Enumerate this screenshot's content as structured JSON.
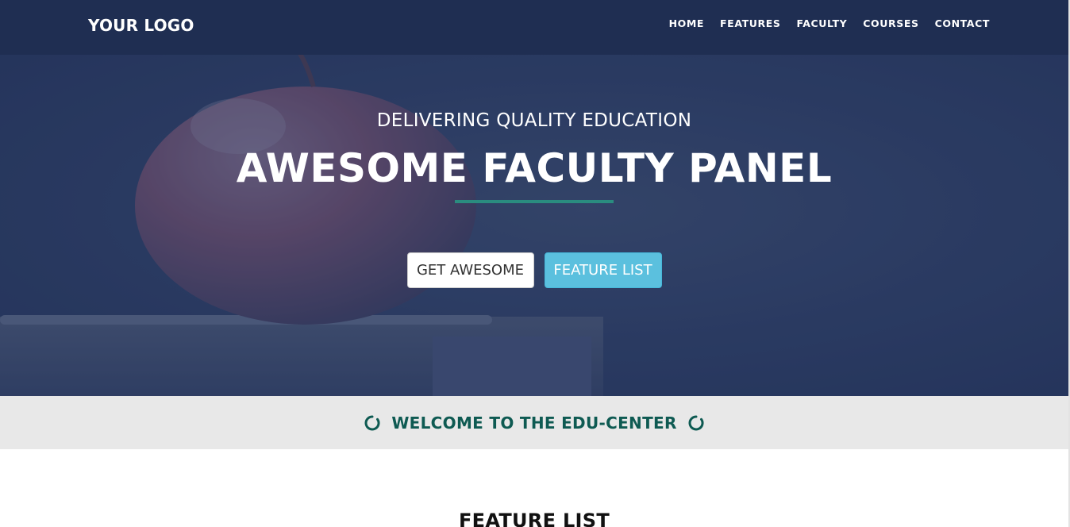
{
  "brand": {
    "logo": "YOUR LOGO"
  },
  "nav": {
    "items": [
      {
        "label": "HOME"
      },
      {
        "label": "FEATURES"
      },
      {
        "label": "FACULTY"
      },
      {
        "label": "COURSES"
      },
      {
        "label": "CONTACT"
      }
    ]
  },
  "hero": {
    "subtitle": "DELIVERING QUALITY EDUCATION",
    "title": "AWESOME FACULTY PANEL",
    "buttons": {
      "primary_label": "GET AWESOME",
      "secondary_label": "FEATURE LIST"
    }
  },
  "welcome": {
    "text": "WELCOME TO THE EDU-CENTER"
  },
  "feature": {
    "title": "FEATURE LIST"
  },
  "colors": {
    "navbar": "#1f2e52",
    "hero_overlay": "#2d3d63",
    "accent_line": "#2a8c7f",
    "info_button": "#5bc0de",
    "welcome_text": "#0e5a52",
    "welcome_band": "#e8e8e8"
  }
}
